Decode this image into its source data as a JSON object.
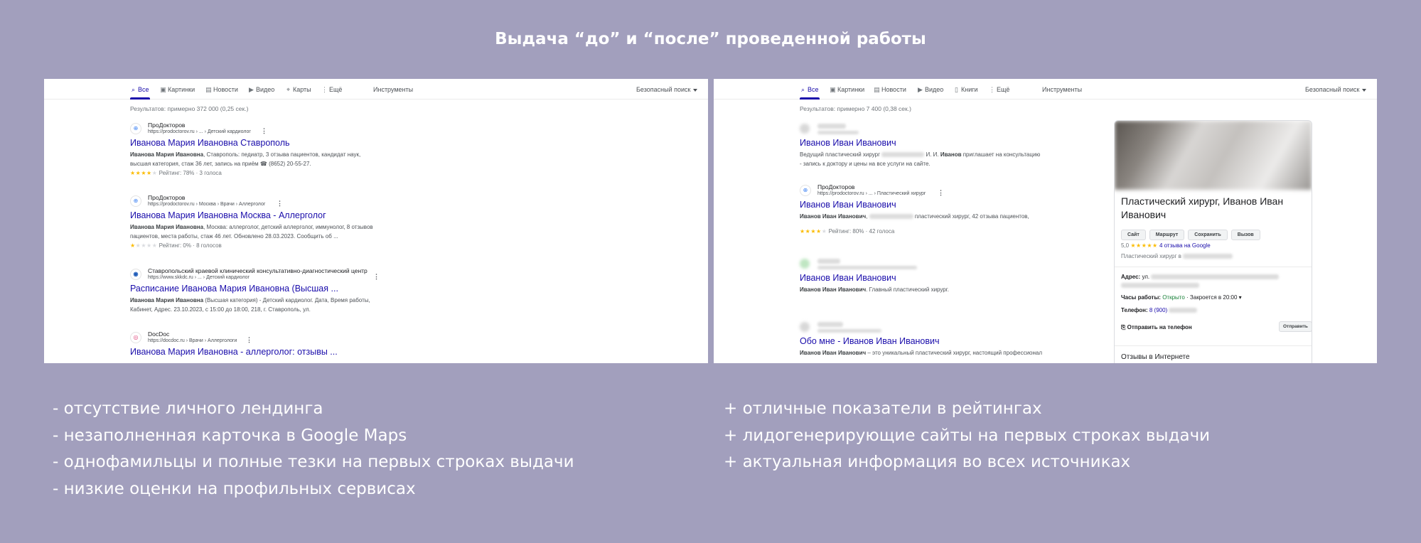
{
  "title": "Выдача “до” и “после” проведенной работы",
  "colors": {
    "background": "#a29fbd",
    "link": "#1a0dab",
    "star": "#fbbc04",
    "open_status": "#188038"
  },
  "before": {
    "tabs": [
      {
        "label": "Все",
        "icon": "search-icon",
        "active": true
      },
      {
        "label": "Картинки",
        "icon": "image-icon"
      },
      {
        "label": "Новости",
        "icon": "news-icon"
      },
      {
        "label": "Видео",
        "icon": "video-icon"
      },
      {
        "label": "Карты",
        "icon": "map-pin-icon"
      },
      {
        "label": "Ещё",
        "icon": "more-vert-icon"
      }
    ],
    "tools": "Инструменты",
    "safe_search": "Безопасный поиск",
    "stats": "Результатов: примерно 372 000 (0,25 сек.)",
    "results": [
      {
        "site": "ПроДокторов",
        "url": "https://prodoctorov.ru › ... › Детский кардиолог",
        "title": "Иванова Мария Ивановна Ставрополь",
        "snippet_bold": "Иванова Мария Ивановна",
        "snippet_line1": ", Ставрополь: педиатр, 3 отзыва пациентов, кандидат наук,",
        "snippet_line2": "высшая категория, стаж 36 лет, запись на приём ☎ (8652) 20-55-27.",
        "stars_on": "★★★★",
        "stars_off": "★",
        "rating": "Рейтинг: 78% · 3 голоса"
      },
      {
        "site": "ПроДокторов",
        "url": "https://prodoctorov.ru › Москва › Врачи › Аллерголог",
        "title": "Иванова Мария Ивановна Москва - Аллерголог",
        "snippet_bold": "Иванова Мария Ивановна",
        "snippet_line1": ", Москва: аллерголог, детский аллерголог, иммунолог, 8 отзывов",
        "snippet_line2": "пациентов, места работы, стаж 46 лет. Обновлено 28.03.2023. Сообщить об ...",
        "stars_on": "★",
        "stars_off": "★★★★",
        "rating": "Рейтинг: 0% · 8 голосов"
      },
      {
        "site": "Ставропольский краевой клинический консультативно-диагностический центр",
        "url": "https://www.skkdc.ru › ... › Детский кардиолог",
        "title": "Расписание Иванова Мария Ивановна (Высшая ...",
        "snippet_bold": "Иванова Мария Ивановна",
        "snippet_line1": " (Высшая категория) - Детский кардиолог. Дата, Время работы,",
        "snippet_line2": "Кабинет, Адрес. 23.10.2023, с 15:00 до 18:00, 218, г. Ставрополь, ул."
      },
      {
        "site": "DocDoc",
        "url": "https://docdoc.ru › Врачи › Аллергологи",
        "title": "Иванова Мария Ивановна - аллерголог: отзывы ..."
      }
    ]
  },
  "after": {
    "tabs": [
      {
        "label": "Все",
        "icon": "search-icon",
        "active": true
      },
      {
        "label": "Картинки",
        "icon": "image-icon"
      },
      {
        "label": "Новости",
        "icon": "news-icon"
      },
      {
        "label": "Видео",
        "icon": "video-icon"
      },
      {
        "label": "Книги",
        "icon": "book-icon"
      },
      {
        "label": "Ещё",
        "icon": "more-vert-icon"
      }
    ],
    "tools": "Инструменты",
    "safe_search": "Безопасный поиск",
    "stats": "Результатов: примерно 7 400 (0,38 сек.)",
    "results": [
      {
        "title": "Иванов Иван Иванович",
        "snippet_line1a": "Ведущий пластический хирург",
        "snippet_line1b": " И. И. ",
        "snippet_line1_bold": "Иванов",
        "snippet_line1c": " приглашает на консультацию",
        "snippet_line2": "- запись к доктору и цены на все услуги на сайте."
      },
      {
        "site": "ПроДокторов",
        "url": "https://prodoctorov.ru › ... › Пластический хирург",
        "title": "Иванов Иван Иванович",
        "snippet_bold": "Иванов Иван Иванович",
        "snippet_line1": " пластический хирург, 42 отзыва пациентов,",
        "stars_on": "★★★★",
        "stars_off": "★",
        "rating": "Рейтинг: 80% · 42 голоса"
      },
      {
        "title": "Иванов Иван Иванович",
        "snippet_bold": "Иванов Иван Иванович",
        "snippet_line1": ". Главный пластический хирург."
      },
      {
        "title": "Обо мне - Иванов Иван Иванович",
        "snippet_bold": "Иванов Иван Иванович",
        "snippet_line1": " – это уникальный пластический хирург, настоящий профессионал"
      }
    ],
    "knowledge_panel": {
      "name": "Пластический хирург, Иванов Иван Иванович",
      "buttons": [
        "Сайт",
        "Маршрут",
        "Сохранить",
        "Вызов"
      ],
      "rating_value": "5,0",
      "stars": "★★★★★",
      "reviews_link": "4 отзыва на Google",
      "category": "Пластический хирург в",
      "address_label": "Адрес:",
      "address_value": "ул.",
      "hours_label": "Часы работы:",
      "hours_status": "Открыто",
      "hours_close": " · Закроется в 20:00 ▾",
      "phone_label": "Телефон:",
      "phone_value": "8 (900)",
      "send_label": "Отправить на телефон",
      "send_button": "Отправить",
      "reviews_heading": "Отзывы в Интернете"
    }
  },
  "bullets_left": [
    "- отсутствие личного лендинга",
    "- незаполненная карточка в Google Maps",
    "- однофамильцы и полные тезки на первых строках выдачи",
    "- низкие оценки на профильных сервисах"
  ],
  "bullets_right": [
    "+ отличные показатели в рейтингах",
    "+ лидогенерирующие сайты на первых строках выдачи",
    "+ актуальная информация во всех источниках"
  ]
}
